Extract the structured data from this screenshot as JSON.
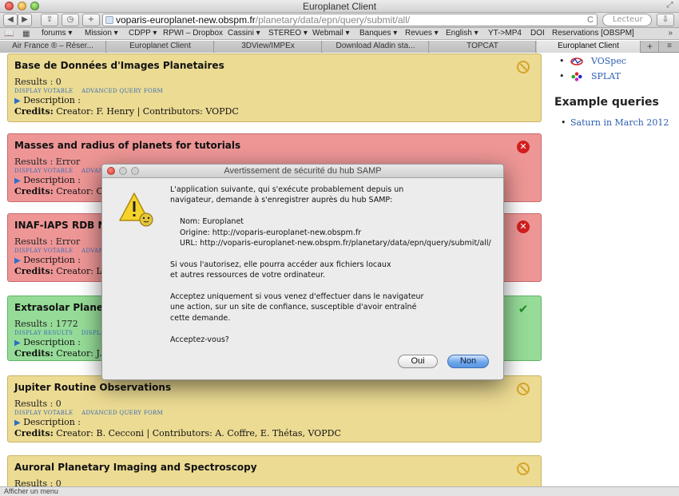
{
  "window": {
    "title": "Europlanet Client"
  },
  "nav": {
    "back_label": "◀",
    "forward_label": "▶",
    "share_label": "⇪",
    "history_label": "◷",
    "new_tab_label": "+",
    "url_host": "voparis-europlanet-new.obspm.fr",
    "url_path": "/planetary/data/epn/query/submit/all/",
    "reload_label": "C",
    "reader_label": "Lecteur",
    "download_label": "⇩"
  },
  "bookmarks": {
    "items": [
      "forums ▾",
      "Mission ▾",
      "CDPP ▾",
      "RPWI – Dropbox",
      "Cassini ▾",
      "STEREO ▾",
      "Webmail ▾",
      "Banques ▾",
      "Revues ▾",
      "English ▾",
      "YT->MP4",
      "DOI",
      "Reservations [OBSPM]"
    ],
    "more_label": "»"
  },
  "tabs": {
    "items": [
      {
        "label": "Air France ® – Réser...",
        "active": false
      },
      {
        "label": "Europlanet Client",
        "active": false
      },
      {
        "label": "3DView/IMPEx",
        "active": false
      },
      {
        "label": "Download Aladin sta...",
        "active": false
      },
      {
        "label": "TOPCAT",
        "active": false
      },
      {
        "label": "Europlanet Client",
        "active": true
      }
    ],
    "add_label": "+",
    "list_label": "≡"
  },
  "cards": [
    {
      "status": "noentry",
      "color": "yellow",
      "title": "Base de Données d'Images Planetaires",
      "results": "Results : 0",
      "links": [
        "DISPLAY VOTABLE",
        "ADVANCED QUERY FORM"
      ],
      "description": "Description :",
      "credits_label": "Credits:",
      "credits": " Creator: F. Henry | Contributors: VOPDC"
    },
    {
      "status": "error",
      "color": "red",
      "title": "Masses and radius of planets for tutorials",
      "results": "Results : Error",
      "links": [
        "DISPLAY VOTABLE",
        "ADVANC"
      ],
      "description": "Description :",
      "credits_label": "Credits:",
      "credits": " Creator: Obse"
    },
    {
      "status": "error",
      "color": "red",
      "title": "INAF-IAPS RDB NAS",
      "results": "Results : Error",
      "links": [
        "DISPLAY VOTABLE",
        "ADVANC"
      ],
      "description": "Description :",
      "credits_label": "Credits:",
      "credits": " Creator: IA2"
    },
    {
      "status": "ok",
      "color": "green",
      "title": "Extrasolar Planets E",
      "results": "Results : 1772",
      "links": [
        "DISPLAY RESULTS",
        "DISPLAY V"
      ],
      "description": "Description :",
      "credits_label": "Credits:",
      "credits": " Creator: J. Sch"
    },
    {
      "status": "noentry",
      "color": "yellow",
      "title": "Jupiter Routine Observations",
      "results": "Results : 0",
      "links": [
        "DISPLAY VOTABLE",
        "ADVANCED QUERY FORM"
      ],
      "description": "Description :",
      "credits_label": "Credits:",
      "credits": " Creator: B. Cecconi | Contributors: A. Coffre, E. Thétas, VOPDC"
    },
    {
      "status": "noentry",
      "color": "yellow",
      "title": "Auroral Planetary Imaging and Spectroscopy",
      "results": "Results : 0",
      "links": [],
      "description": "",
      "credits_label": "",
      "credits": ""
    }
  ],
  "sidebar": {
    "tools": [
      {
        "label": "VOSpec",
        "icon": "vospec-icon"
      },
      {
        "label": "SPLAT",
        "icon": "splat-icon"
      }
    ],
    "examples_heading": "Example queries",
    "examples": [
      "Saturn in March 2012"
    ]
  },
  "status_bar": {
    "text": "Afficher un menu"
  },
  "dialog": {
    "title": "Avertissement de sécurité du hub SAMP",
    "intro_1": "L'application suivante, qui s'exécute probablement depuis un",
    "intro_2": "navigateur, demande à s'enregistrer auprès du hub SAMP:",
    "name_line": "Nom: Europlanet",
    "origin_line": "Origine: http://voparis-europlanet-new.obspm.fr",
    "url_line": "URL: http://voparis-europlanet-new.obspm.fr/planetary/data/epn/query/submit/all/",
    "access_1": "Si vous l'autorisez, elle pourra accéder aux fichiers locaux",
    "access_2": "et autres ressources de votre ordinateur.",
    "accept_1": "Acceptez uniquement si vous venez d'effectuer dans le navigateur",
    "accept_2": "une action, sur un site de confiance, susceptible d'avoir entraîné",
    "accept_3": "cette demande.",
    "question": "Acceptez-vous?",
    "yes_label": "Oui",
    "no_label": "Non"
  },
  "colors": {
    "card_yellow": "#ecdb93",
    "card_red": "#ee9696",
    "card_green": "#96dc98",
    "link_blue": "#2a5db0",
    "default_button": "#5a96e2"
  }
}
